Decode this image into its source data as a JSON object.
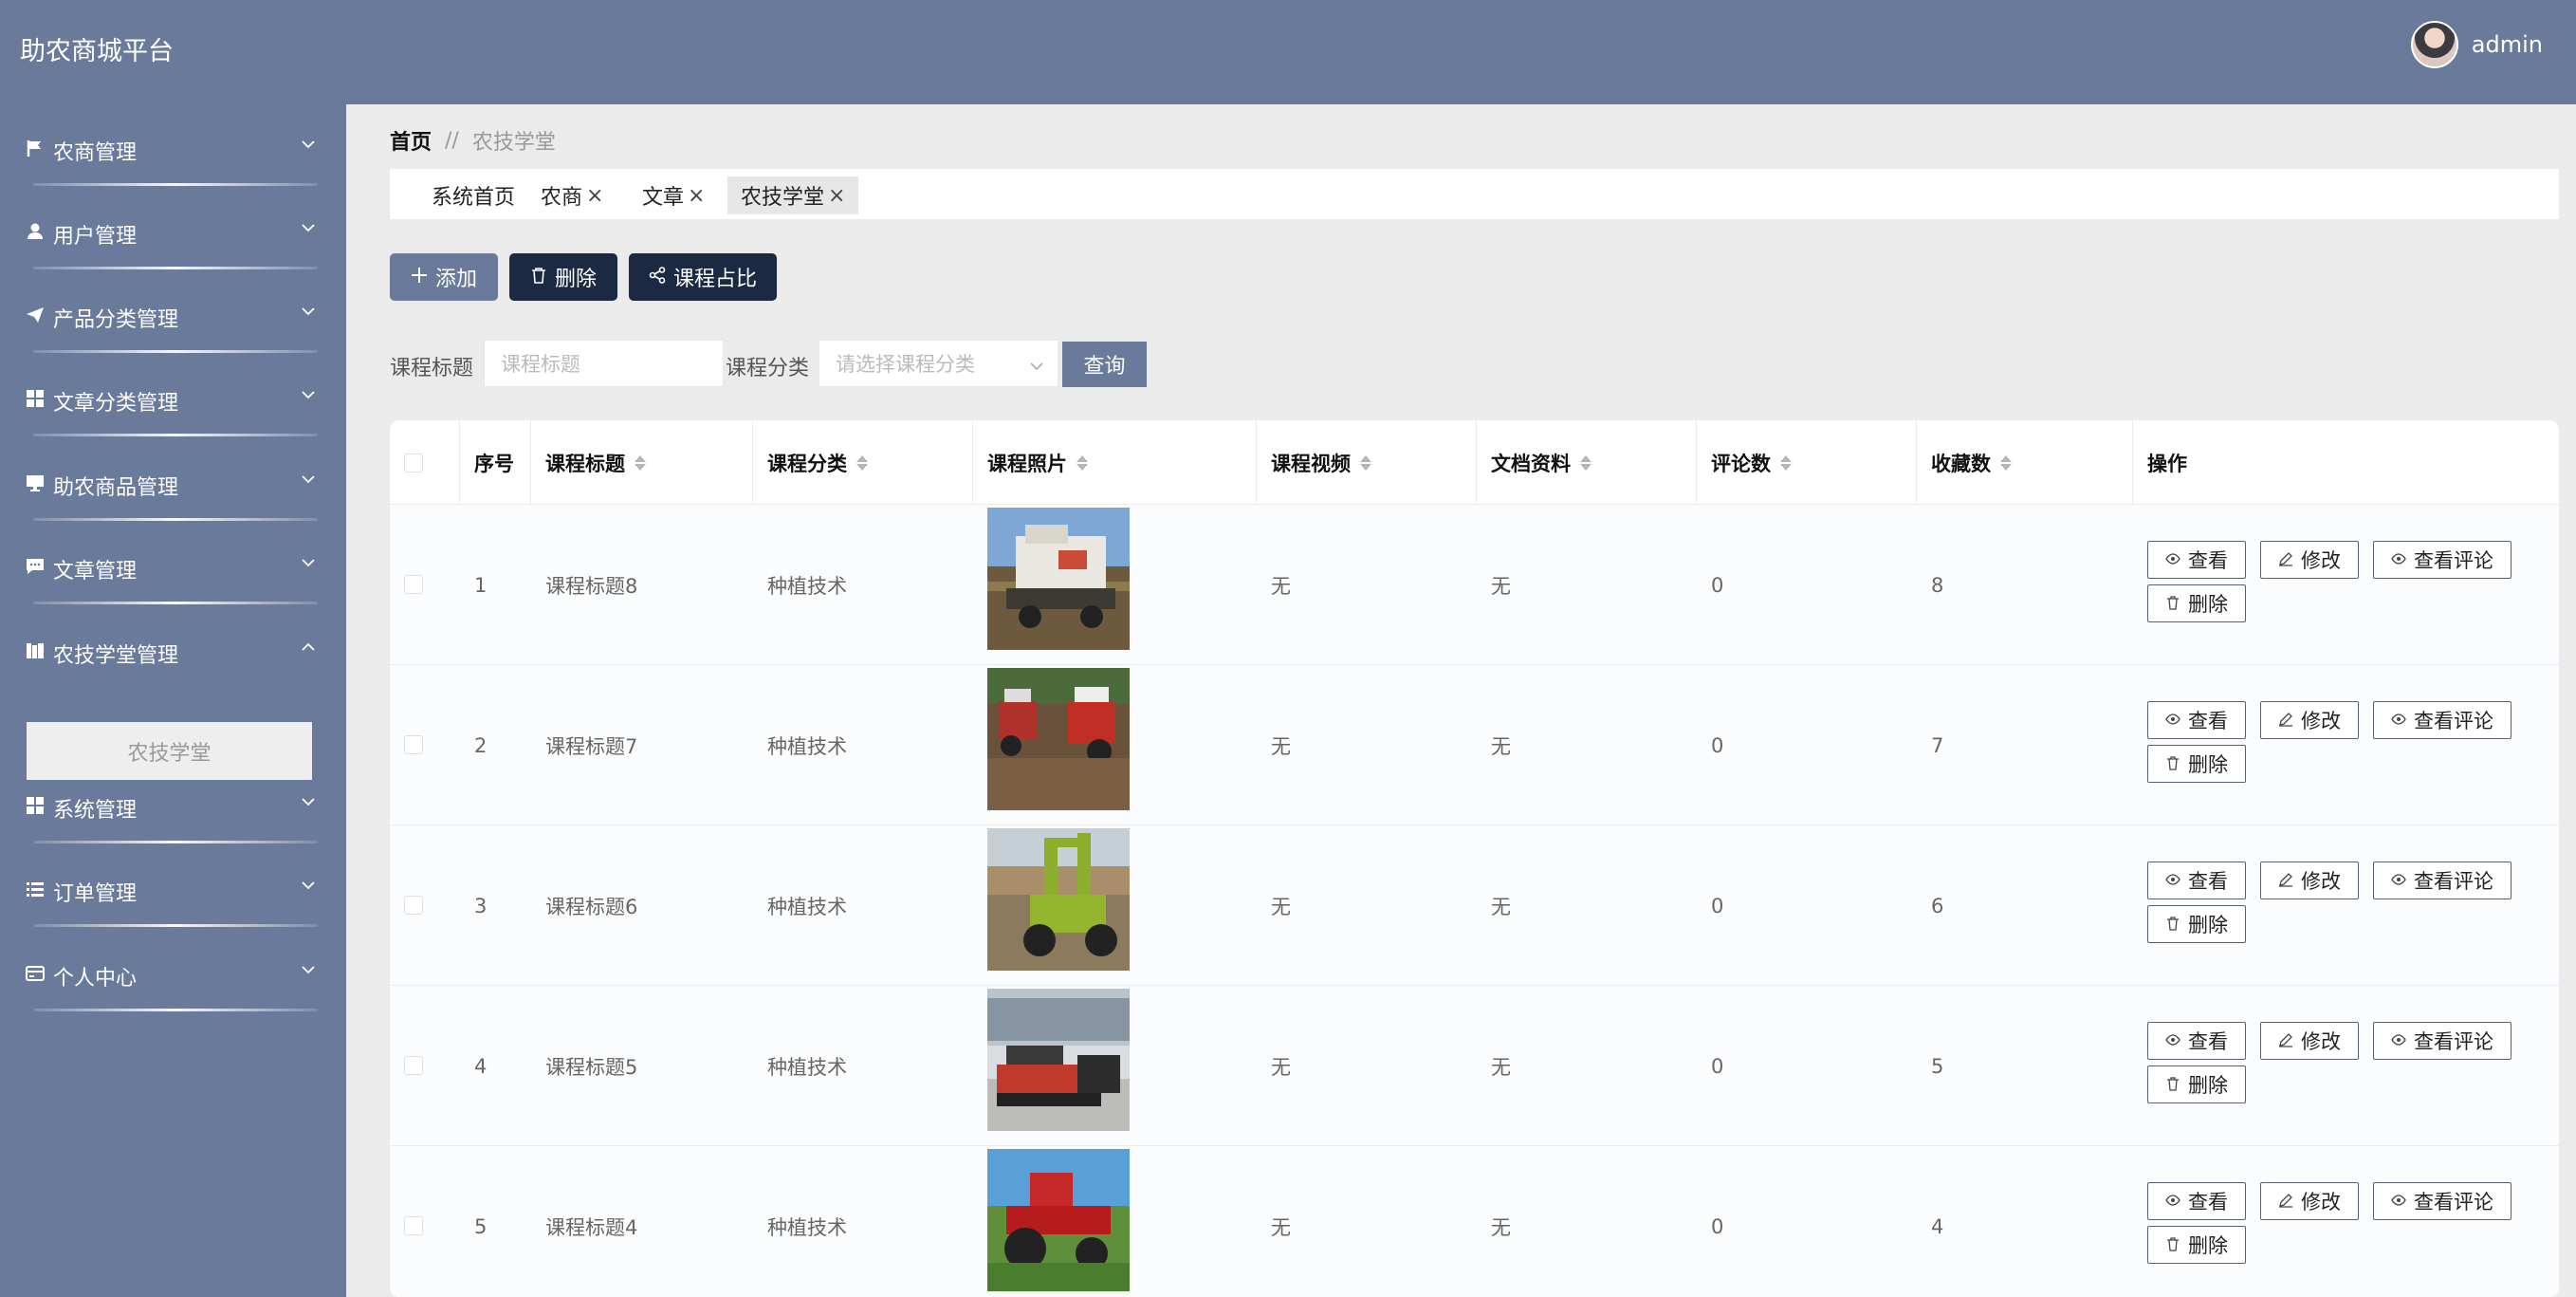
{
  "app": {
    "title": "助农商城平台",
    "username": "admin"
  },
  "sidebar": {
    "items": [
      {
        "label": "农商管理",
        "icon": "flag-icon"
      },
      {
        "label": "用户管理",
        "icon": "user-icon"
      },
      {
        "label": "产品分类管理",
        "icon": "send-icon"
      },
      {
        "label": "文章分类管理",
        "icon": "grid-icon"
      },
      {
        "label": "助农商品管理",
        "icon": "monitor-icon"
      },
      {
        "label": "文章管理",
        "icon": "chat-icon"
      },
      {
        "label": "农技学堂管理",
        "icon": "book-icon"
      },
      {
        "label": "系统管理",
        "icon": "grid-icon"
      },
      {
        "label": "订单管理",
        "icon": "list-icon"
      },
      {
        "label": "个人中心",
        "icon": "card-icon"
      }
    ],
    "submenu_label": "农技学堂"
  },
  "breadcrumb": {
    "home": "首页",
    "separator": "//",
    "current": "农技学堂"
  },
  "tabs": [
    {
      "label": "系统首页",
      "closable": false
    },
    {
      "label": "农商",
      "closable": true
    },
    {
      "label": "文章",
      "closable": true
    },
    {
      "label": "农技学堂",
      "closable": true
    }
  ],
  "tab_close": "×",
  "toolbar": {
    "add": "添加",
    "delete": "删除",
    "ratio": "课程占比"
  },
  "filters": {
    "title_label": "课程标题",
    "title_placeholder": "课程标题",
    "category_label": "课程分类",
    "category_placeholder": "请选择课程分类",
    "query": "查询"
  },
  "table": {
    "columns": [
      "序号",
      "课程标题",
      "课程分类",
      "课程照片",
      "课程视频",
      "文档资料",
      "评论数",
      "收藏数",
      "操作"
    ],
    "rows": [
      {
        "index": "1",
        "title": "课程标题8",
        "category": "种植技术",
        "video": "无",
        "doc": "无",
        "comments": "0",
        "favorites": "8"
      },
      {
        "index": "2",
        "title": "课程标题7",
        "category": "种植技术",
        "video": "无",
        "doc": "无",
        "comments": "0",
        "favorites": "7"
      },
      {
        "index": "3",
        "title": "课程标题6",
        "category": "种植技术",
        "video": "无",
        "doc": "无",
        "comments": "0",
        "favorites": "6"
      },
      {
        "index": "4",
        "title": "课程标题5",
        "category": "种植技术",
        "video": "无",
        "doc": "无",
        "comments": "0",
        "favorites": "5"
      },
      {
        "index": "5",
        "title": "课程标题4",
        "category": "种植技术",
        "video": "无",
        "doc": "无",
        "comments": "0",
        "favorites": "4"
      }
    ],
    "actions": {
      "view": "查看",
      "edit": "修改",
      "view_comments": "查看评论",
      "delete": "删除"
    }
  },
  "colors": {
    "header_bg": "#6a7a9a",
    "dark_button": "#1b2942",
    "page_bg": "#ebebeb"
  }
}
